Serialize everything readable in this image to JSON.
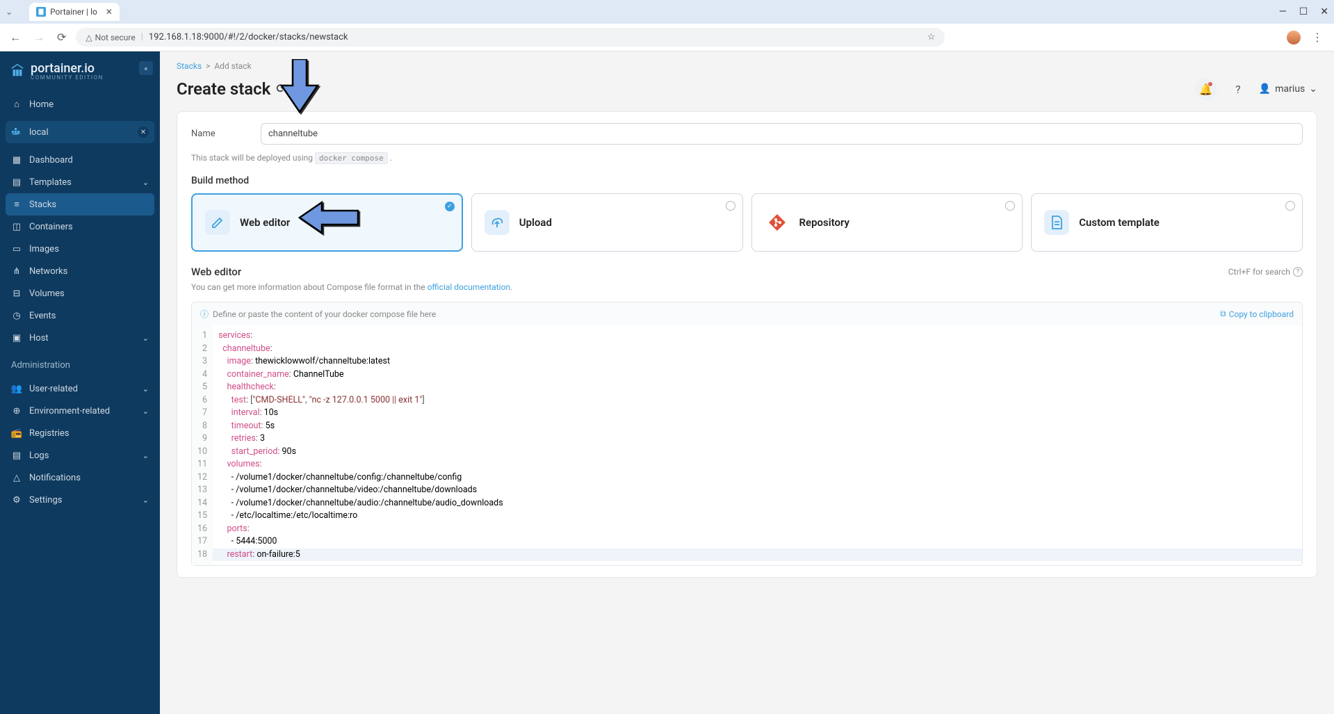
{
  "browser": {
    "tab_title": "Portainer | lo",
    "not_secure": "Not secure",
    "url": "192.168.1.18:9000/#!/2/docker/stacks/newstack"
  },
  "sidebar": {
    "brand": "portainer.io",
    "brand_sub": "COMMUNITY EDITION",
    "home": "Home",
    "env_label": "local",
    "items": [
      {
        "label": "Dashboard"
      },
      {
        "label": "Templates",
        "chev": true
      },
      {
        "label": "Stacks",
        "active": true
      },
      {
        "label": "Containers"
      },
      {
        "label": "Images"
      },
      {
        "label": "Networks"
      },
      {
        "label": "Volumes"
      },
      {
        "label": "Events"
      },
      {
        "label": "Host",
        "chev": true
      }
    ],
    "admin_heading": "Administration",
    "admin_items": [
      {
        "label": "User-related",
        "chev": true
      },
      {
        "label": "Environment-related",
        "chev": true
      },
      {
        "label": "Registries"
      },
      {
        "label": "Logs",
        "chev": true
      },
      {
        "label": "Notifications"
      },
      {
        "label": "Settings",
        "chev": true
      }
    ]
  },
  "breadcrumb": {
    "root": "Stacks",
    "current": "Add stack"
  },
  "header": {
    "title": "Create stack",
    "user": "marius"
  },
  "form": {
    "name_label": "Name",
    "name_value": "channeltube",
    "deploy_note_pre": "This stack will be deployed using ",
    "deploy_note_code": "docker compose",
    "deploy_note_post": " .",
    "build_method_title": "Build method",
    "methods": {
      "web_editor": "Web editor",
      "upload": "Upload",
      "repository": "Repository",
      "custom_template": "Custom template"
    }
  },
  "editor": {
    "title": "Web editor",
    "search_hint": "Ctrl+F for search",
    "desc_pre": "You can get more information about Compose file format in the ",
    "desc_link": "official documentation",
    "desc_post": ".",
    "toolbar_hint": "Define or paste the content of your docker compose file here",
    "copy_label": "Copy to clipboard",
    "lines": [
      {
        "n": 1,
        "segs": [
          [
            "k",
            "services"
          ],
          [
            "p",
            ":"
          ]
        ]
      },
      {
        "n": 2,
        "segs": [
          [
            "t",
            "  "
          ],
          [
            "k",
            "channeltube"
          ],
          [
            "p",
            ":"
          ]
        ]
      },
      {
        "n": 3,
        "segs": [
          [
            "t",
            "    "
          ],
          [
            "k",
            "image"
          ],
          [
            "p",
            ": "
          ],
          [
            "t",
            "thewicklowwolf/channeltube:latest"
          ]
        ]
      },
      {
        "n": 4,
        "segs": [
          [
            "t",
            "    "
          ],
          [
            "k",
            "container_name"
          ],
          [
            "p",
            ": "
          ],
          [
            "t",
            "ChannelTube"
          ]
        ]
      },
      {
        "n": 5,
        "segs": [
          [
            "t",
            "    "
          ],
          [
            "k",
            "healthcheck"
          ],
          [
            "p",
            ":"
          ]
        ]
      },
      {
        "n": 6,
        "segs": [
          [
            "t",
            "      "
          ],
          [
            "k",
            "test"
          ],
          [
            "p",
            ": ["
          ],
          [
            "s",
            "\"CMD-SHELL\""
          ],
          [
            "p",
            ", "
          ],
          [
            "s",
            "\"nc -z 127.0.0.1 5000 || exit 1\""
          ],
          [
            "p",
            "]"
          ]
        ]
      },
      {
        "n": 7,
        "segs": [
          [
            "t",
            "      "
          ],
          [
            "k",
            "interval"
          ],
          [
            "p",
            ": "
          ],
          [
            "t",
            "10s"
          ]
        ]
      },
      {
        "n": 8,
        "segs": [
          [
            "t",
            "      "
          ],
          [
            "k",
            "timeout"
          ],
          [
            "p",
            ": "
          ],
          [
            "t",
            "5s"
          ]
        ]
      },
      {
        "n": 9,
        "segs": [
          [
            "t",
            "      "
          ],
          [
            "k",
            "retries"
          ],
          [
            "p",
            ": "
          ],
          [
            "t",
            "3"
          ]
        ]
      },
      {
        "n": 10,
        "segs": [
          [
            "t",
            "      "
          ],
          [
            "k",
            "start_period"
          ],
          [
            "p",
            ": "
          ],
          [
            "t",
            "90s"
          ]
        ]
      },
      {
        "n": 11,
        "segs": [
          [
            "t",
            "    "
          ],
          [
            "k",
            "volumes"
          ],
          [
            "p",
            ":"
          ]
        ]
      },
      {
        "n": 12,
        "segs": [
          [
            "t",
            "      - /volume1/docker/channeltube/config:/channeltube/config"
          ]
        ]
      },
      {
        "n": 13,
        "segs": [
          [
            "t",
            "      - /volume1/docker/channeltube/video:/channeltube/downloads"
          ]
        ]
      },
      {
        "n": 14,
        "segs": [
          [
            "t",
            "      - /volume1/docker/channeltube/audio:/channeltube/audio_downloads"
          ]
        ]
      },
      {
        "n": 15,
        "segs": [
          [
            "t",
            "      - /etc/localtime:/etc/localtime:ro"
          ]
        ]
      },
      {
        "n": 16,
        "segs": [
          [
            "t",
            "    "
          ],
          [
            "k",
            "ports"
          ],
          [
            "p",
            ":"
          ]
        ]
      },
      {
        "n": 17,
        "segs": [
          [
            "t",
            "      - 5444:5000"
          ]
        ]
      },
      {
        "n": 18,
        "hl": true,
        "segs": [
          [
            "t",
            "    "
          ],
          [
            "k",
            "restart"
          ],
          [
            "p",
            ": "
          ],
          [
            "t",
            "on-failure:5"
          ]
        ]
      }
    ]
  },
  "icons": {
    "home": "⌂",
    "dashboard": "▦",
    "templates": "▤",
    "stacks": "≡",
    "containers": "◫",
    "images": "▭",
    "networks": "⋔",
    "volumes": "⊟",
    "events": "◷",
    "host": "▣",
    "users": "⛭",
    "env": "⊕",
    "registries": "⟐",
    "logs": "▤",
    "notif": "△",
    "settings": "⚙"
  }
}
